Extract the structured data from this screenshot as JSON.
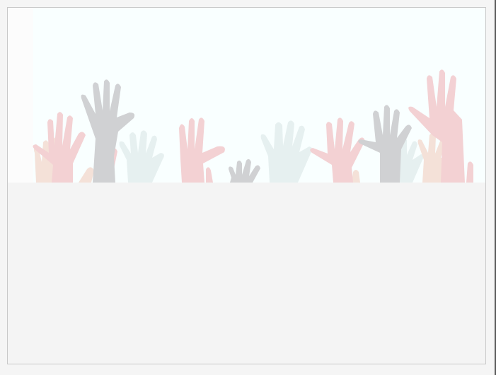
{
  "page": {
    "background_color": "#f5f5f5",
    "frame_border_color": "#c9c9c9"
  },
  "banner": {
    "image_subject": "raised-hands-illustration",
    "background_color": "#f9ffff",
    "hand_colors": [
      "#f2c9cc",
      "#c9c9cc",
      "#e3eeee",
      "#f4dcd2"
    ]
  },
  "content": {
    "background_color": "#f4f4f4"
  }
}
